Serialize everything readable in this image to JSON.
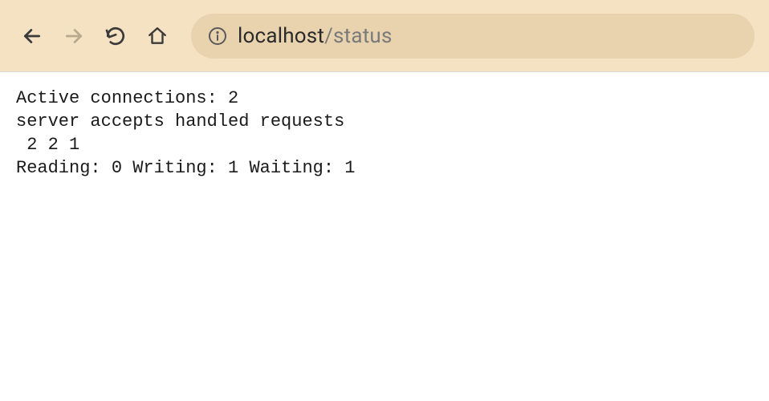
{
  "browser": {
    "url_host": "localhost",
    "url_path": "/status"
  },
  "status": {
    "line1": "Active connections: 2 ",
    "line2": "server accepts handled requests",
    "line3": " 2 2 1 ",
    "line4": "Reading: 0 Writing: 1 Waiting: 1 "
  }
}
